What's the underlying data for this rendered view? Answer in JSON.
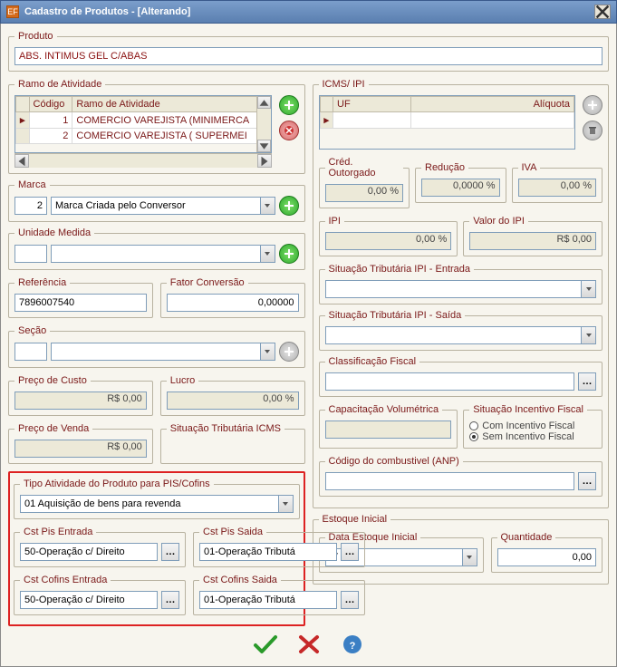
{
  "window": {
    "title": "Cadastro de Produtos - [Alterando]",
    "app_icon_text": "EF"
  },
  "produto": {
    "legend": "Produto",
    "value": "ABS. INTIMUS GEL C/ABAS"
  },
  "ramo": {
    "legend": "Ramo de Atividade",
    "col_codigo": "Código",
    "col_ramo": "Ramo de Atividade",
    "rows": [
      {
        "codigo": "1",
        "desc": "COMERCIO VAREJISTA (MINIMERCA"
      },
      {
        "codigo": "2",
        "desc": "COMERCIO VAREJISTA ( SUPERMEI"
      }
    ]
  },
  "marca": {
    "legend": "Marca",
    "code": "2",
    "desc": "Marca Criada pelo Conversor"
  },
  "unidade": {
    "legend": "Unidade Medida",
    "value": ""
  },
  "referencia": {
    "legend": "Referência",
    "value": "7896007540"
  },
  "fator": {
    "legend": "Fator Conversão",
    "value": "0,00000"
  },
  "secao": {
    "legend": "Seção",
    "value": ""
  },
  "preco_custo": {
    "legend": "Preço de Custo",
    "value": "R$ 0,00"
  },
  "lucro": {
    "legend": "Lucro",
    "value": "0,00 %"
  },
  "preco_venda": {
    "legend": "Preço de Venda",
    "value": "R$ 0,00"
  },
  "sit_icms": {
    "legend": "Situação Tributária ICMS"
  },
  "piscofins": {
    "tipo_legend": "Tipo Atividade do Produto para PIS/Cofins",
    "tipo_value": "01 Aquisição de bens para revenda",
    "pis_entrada_legend": "Cst Pis Entrada",
    "pis_entrada_value": "50-Operação c/ Direito",
    "pis_saida_legend": "Cst Pis Saida",
    "pis_saida_value": "01-Operação Tributá",
    "cofins_entrada_legend": "Cst Cofins Entrada",
    "cofins_entrada_value": "50-Operação c/ Direito",
    "cofins_saida_legend": "Cst Cofins Saida",
    "cofins_saida_value": "01-Operação Tributá"
  },
  "icms_ipi": {
    "legend": "ICMS/ IPI",
    "col_uf": "UF",
    "col_aliquota": "Alíquota"
  },
  "cred_outorgado": {
    "legend": "Créd. Outorgado",
    "value": "0,00 %"
  },
  "reducao": {
    "legend": "Redução",
    "value": "0,0000 %"
  },
  "iva": {
    "legend": "IVA",
    "value": "0,00 %"
  },
  "ipi": {
    "legend": "IPI",
    "value": "0,00 %"
  },
  "valor_ipi": {
    "legend": "Valor do IPI",
    "value": "R$ 0,00"
  },
  "sit_ipi_entrada": {
    "legend": "Situação Tributária IPI - Entrada"
  },
  "sit_ipi_saida": {
    "legend": "Situação Tributária IPI - Saída"
  },
  "class_fiscal": {
    "legend": "Classificação Fiscal"
  },
  "cap_vol": {
    "legend": "Capacitação Volumétrica",
    "value": ""
  },
  "incentivo": {
    "legend": "Situação Incentivo Fiscal",
    "opt_com": "Com Incentivo Fiscal",
    "opt_sem": "Sem Incentivo Fiscal"
  },
  "cod_combustivel": {
    "legend": "Código do combustivel (ANP)",
    "value": ""
  },
  "estoque": {
    "legend": "Estoque Inicial",
    "data_legend": "Data Estoque Inicial",
    "data_value": "/ /",
    "qtd_legend": "Quantidade",
    "qtd_value": "0,00"
  }
}
